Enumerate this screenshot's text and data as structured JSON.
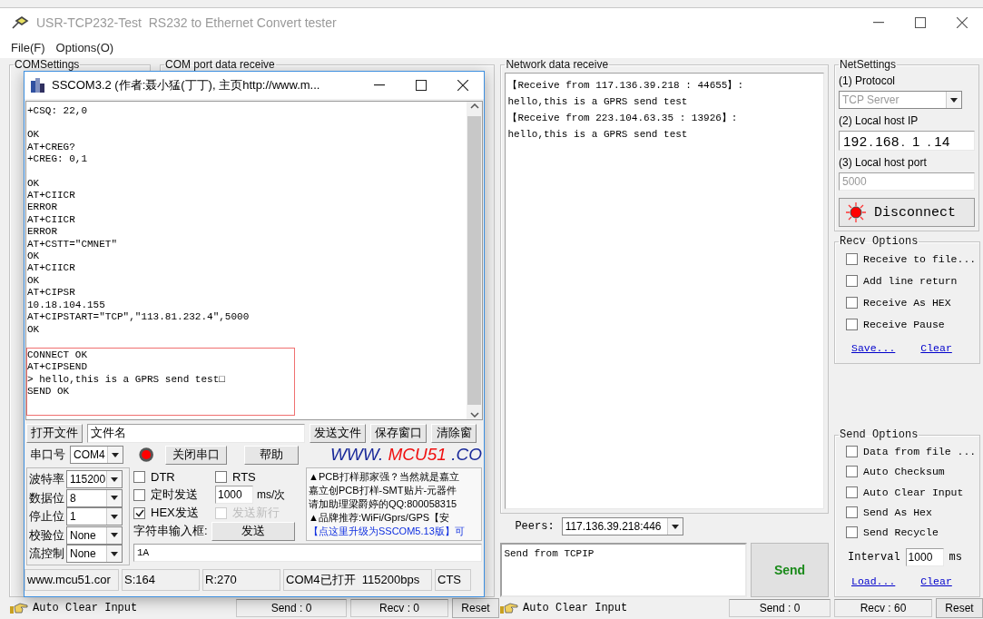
{
  "window": {
    "title": "USR-TCP232-Test  RS232 to Ethernet Convert tester",
    "menu": [
      "File(F)",
      "Options(O)"
    ]
  },
  "com_groups": [
    "COMSettings",
    "COM port data receive"
  ],
  "sscom": {
    "title": "SSCOM3.2 (作者:聂小猛(丁丁), 主页http://www.m...",
    "log_blocks": [
      [
        "+CSQ: 22,0"
      ],
      [
        "OK",
        "AT+CREG?",
        "+CREG: 0,1"
      ],
      [
        "OK",
        "AT+CIICR",
        "ERROR",
        "AT+CIICR",
        "ERROR",
        "AT+CSTT=\"CMNET\"",
        "OK",
        "AT+CIICR",
        "OK",
        "AT+CIPSR",
        "10.18.104.155",
        "AT+CIPSTART=\"TCP\",\"113.81.232.4\",5000",
        "OK"
      ]
    ],
    "highlight_block": [
      "CONNECT OK",
      "AT+CIPSEND",
      "> hello,this is a GPRS send test□",
      "SEND OK"
    ],
    "file_row": {
      "open": "打开文件",
      "file": "文件名",
      "buttons": [
        "发送文件",
        "保存窗口",
        "清除窗"
      ]
    },
    "port_row": {
      "label": "串口号",
      "port": "COM4",
      "port_open": true,
      "close": "关闭串口",
      "help": "帮助"
    },
    "logo": {
      "prefix": "WWW.",
      "brand": "MCU51",
      "suffix": ".CO"
    },
    "settings": [
      {
        "label": "波特率",
        "value": "115200"
      },
      {
        "label": "数据位",
        "value": "8"
      },
      {
        "label": "停止位",
        "value": "1"
      },
      {
        "label": "校验位",
        "value": "None"
      },
      {
        "label": "流控制",
        "value": "None"
      }
    ],
    "checkboxes": [
      {
        "label": "DTR",
        "checked": false,
        "disabled": false
      },
      {
        "label": "RTS",
        "checked": false,
        "disabled": false
      },
      {
        "label": "定时发送",
        "checked": false,
        "disabled": false
      },
      {
        "label": "HEX发送",
        "checked": true,
        "disabled": false
      },
      {
        "label": "发送新行",
        "checked": false,
        "disabled": true
      }
    ],
    "period": {
      "value": "1000",
      "unit": "ms/次"
    },
    "input_label": "字符串输入框:",
    "send": "发送",
    "ads": [
      {
        "kind": "text",
        "text": "▲PCB打样那家强？当然就是嘉立"
      },
      {
        "kind": "text",
        "text": "嘉立创PCB打样-SMT贴片-元器件"
      },
      {
        "kind": "text",
        "text": "请加助理梁爵婷的QQ:800058315"
      },
      {
        "kind": "text",
        "text": "▲品牌推荐:WiFi/Gprs/GPS【安"
      },
      {
        "kind": "link",
        "text": "【点这里升级为SSCOM5.13版】可"
      }
    ],
    "input": "1A",
    "status": [
      "www.mcu51.cor",
      "S:164",
      "R:270",
      "COM4已打开  115200bps",
      "CTS"
    ]
  },
  "network": {
    "title": "Network data receive",
    "lines": [
      "【Receive from 117.136.39.218 : 44655】:",
      "hello,this is a GPRS send test",
      "【Receive from 223.104.63.35 : 13926】:",
      "hello,this is a GPRS send test"
    ],
    "peers_label": "Peers:",
    "peer": "117.136.39.218:446",
    "send_text": "Send from TCPIP",
    "send": "Send"
  },
  "net_settings": {
    "title": "NetSettings",
    "protocol_label": "(1) Protocol",
    "protocol": "TCP Server",
    "ip_label": "(2) Local host IP",
    "ip": [
      "192",
      "168",
      "1",
      "14"
    ],
    "ip_separator": ".",
    "port_label": "(3) Local host port",
    "port": "5000",
    "connected": true,
    "button": "Disconnect"
  },
  "recv_options": {
    "title": "Recv Options",
    "items": [
      {
        "label": "Receive to file...",
        "checked": false
      },
      {
        "label": "Add line return",
        "checked": false
      },
      {
        "label": "Receive As HEX",
        "checked": false
      },
      {
        "label": "Receive Pause",
        "checked": false
      }
    ],
    "links": [
      "Save...",
      "Clear"
    ]
  },
  "send_options": {
    "title": "Send Options",
    "items": [
      {
        "label": "Data from file ...",
        "checked": false
      },
      {
        "label": "Auto Checksum",
        "checked": false
      },
      {
        "label": "Auto Clear Input",
        "checked": false
      },
      {
        "label": "Send As Hex",
        "checked": false
      },
      {
        "label": "Send Recycle",
        "checked": false
      }
    ],
    "interval_label": "Interval",
    "interval": "1000",
    "unit": "ms",
    "links": [
      "Load...",
      "Clear"
    ]
  },
  "footers": [
    {
      "auto_clear": "Auto Clear Input",
      "send": "Send : 0",
      "recv": "Recv : 0",
      "reset": "Reset"
    },
    {
      "auto_clear": "Auto Clear Input",
      "send": "Send : 0",
      "recv": "Recv : 60",
      "reset": "Reset"
    }
  ]
}
